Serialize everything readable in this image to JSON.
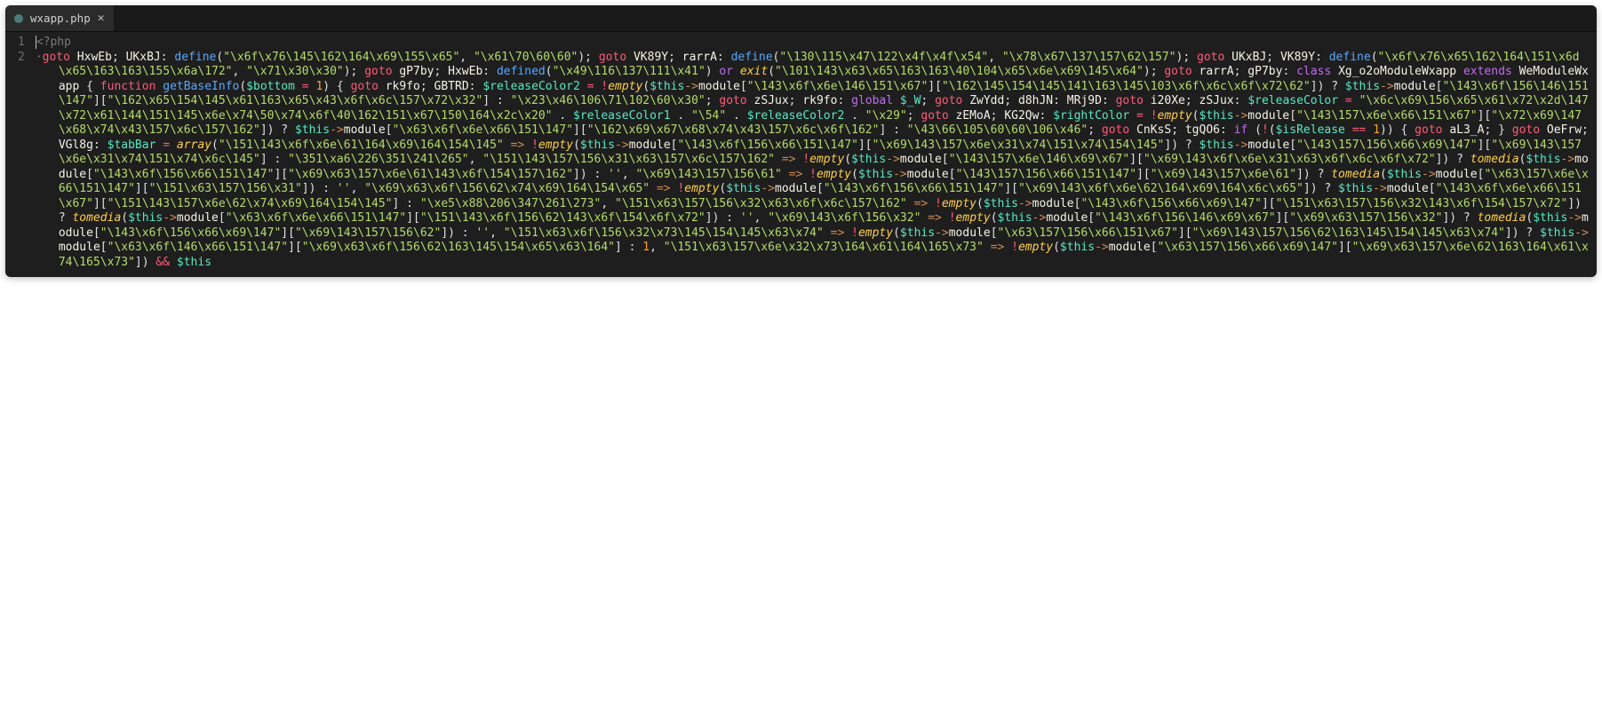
{
  "tab": {
    "filename": "wxapp.php",
    "icon": "php-icon",
    "close": "✕"
  },
  "gutter": {
    "l1": "1",
    "l2": "2"
  },
  "code": {
    "php_open": "<?php",
    "tokens": {
      "goto": "goto",
      "define": "define",
      "defined": "defined",
      "or": "or",
      "exit": "exit",
      "class": "class",
      "extends": "extends",
      "function": "function",
      "global": "global",
      "if": "if",
      "empty": "empty",
      "tomedia": "tomedia",
      "module": "module",
      "arrow": "->",
      "fat_arrow": "=>",
      "and": "&&",
      "array": "array"
    },
    "labels": {
      "HxwEb": "HxwEb",
      "UKxBJ": "UKxBJ",
      "VK89Y": "VK89Y",
      "rarrA": "rarrA",
      "gP7by": "gP7by",
      "rk9fo": "rk9fo",
      "GBTRD": "GBTRD",
      "zSJux": "zSJux",
      "ZwYdd": "ZwYdd",
      "d8hJN": "d8hJN",
      "MRj9D": "MRj9D",
      "i20Xe": "i20Xe",
      "zEMoA": "zEMoA",
      "KG2Qw": "KG2Qw",
      "CnKsS": "CnKsS",
      "tgQO6": "tgQO6",
      "aL3_A": "aL3_A",
      "OeFrw": "OeFrw",
      "VGl8g": "VGl8g"
    },
    "idents": {
      "class_name": "Xg_o2oModuleWxapp",
      "parent": "WeModuleWxapp",
      "fn": "getBaseInfo"
    },
    "vars": {
      "bottom": "$bottom",
      "releaseColor2": "$releaseColor2",
      "releaseColor1": "$releaseColor1",
      "releaseColor": "$releaseColor",
      "rightColor": "$rightColor",
      "W": "$_W",
      "this": "$this",
      "isRelease": "$isRelease",
      "tabBar": "$tabBar"
    },
    "nums": {
      "one": "1",
      "two": "2"
    },
    "strings": {
      "s_overtime_k": "\"\\x6f\\x76\\145\\162\\164\\x69\\155\\x65\"",
      "s_1700": "\"\\x61\\70\\60\\60\"",
      "s_XMGZ": "\"\\130\\115\\x47\\122\\x4f\\x4f\\x54\"",
      "s_xg_o2o": "\"\\x78\\x67\\137\\157\\62\\157\"",
      "s_overtimemjr": "\"\\x6f\\x76\\x65\\162\\164\\151\\x6d\\x65\\163\\163\\155\\x6a\\172\"",
      "s_q00": "\"\\x71\\x30\\x30\"",
      "s_IN_IA": "\"\\x49\\116\\137\\111\\x41\"",
      "s_access_denied": "\"\\101\\143\\x63\\x65\\163\\163\\40\\104\\x65\\x6e\\x69\\145\\x64\"",
      "s_config1": "\"\\143\\x6f\\x6e\\146\\151\\x67\"",
      "s_r_rC1_f": "\"\\162\\145\\154\\145\\141\\163\\145\\103\\x6f\\x6c\\x6f\\x72\\62\"",
      "s_r_rC2_k": "\"\\162\\x65\\154\\145\\x61\\163\\x65\\x43\\x6f\\x6c\\157\\x72\\x32\"",
      "s_config2": "\"\\143\\x6f\\156\\146\\151\\147\"",
      "s_hex1": "\"\\x23\\x46\\106\\71\\102\\60\\x30\"",
      "s_linear1": "\"\\x6c\\x69\\156\\x65\\x61\\x72\\x2d\\147\\x72\\x61\\144\\151\\145\\x6e\\x74\\50\\x74\\x6f\\40\\162\\151\\x67\\150\\164\\x2c\\x20\"",
      "s_54": "\"\\54\"",
      "s_29": "\"\\x29\"",
      "s_config3": "\"\\143\\157\\x6e\\x66\\151\\x67\"",
      "s_rightColor_k": "\"\\x72\\x69\\147\\x68\\x74\\x43\\157\\x6c\\157\\162\"",
      "s_config4": "\"\\x63\\x6f\\x6e\\x66\\151\\147\"",
      "s_rightColor_f": "\"\\162\\x69\\x67\\x68\\x74\\x43\\157\\x6c\\x6f\\162\"",
      "s_hex2": "\"\\43\\66\\105\\60\\60\\106\\x46\"",
      "s_icon1title_a": "\"\\151\\143\\x6f\\x6e\\61\\164\\x69\\164\\154\\145\"",
      "s_config5": "\"\\143\\x6f\\156\\x66\\151\\147\"",
      "s_icon1title_b": "\"\\x69\\143\\157\\x6e\\x31\\x74\\151\\x74\\154\\145\"",
      "s_config6": "\"\\143\\157\\156\\x66\\x69\\147\"",
      "s_icon1title_c": "\"\\x69\\143\\157\\x6e\\x31\\x74\\151\\x74\\x6c\\145\"",
      "s_cn1": "\"\\351\\xa6\\226\\351\\241\\265\"",
      "s_icon1color_k": "\"\\151\\143\\157\\156\\x31\\x63\\157\\x6c\\157\\162\"",
      "s_config7": "\"\\143\\157\\x6e\\146\\x69\\x67\"",
      "s_icon1color_f": "\"\\x69\\143\\x6f\\x6e\\x31\\x63\\x6f\\x6c\\x6f\\x72\"",
      "s_config8": "\"\\143\\x6f\\156\\x66\\151\\147\"",
      "s_icon1color_b": "\"\\x69\\x63\\157\\x6e\\61\\143\\x6f\\154\\157\\162\"",
      "s_icon1_k": "\"\\x69\\143\\157\\156\\61\"",
      "s_config9": "\"\\143\\157\\156\\x66\\151\\147\"",
      "s_icon1_f": "\"\\x69\\143\\157\\x6e\\61\"",
      "s_config10": "\"\\x63\\157\\x6e\\x66\\151\\147\"",
      "s_icon1_b": "\"\\151\\x63\\157\\156\\x31\"",
      "s_icon2title_k": "\"\\x69\\x63\\x6f\\156\\62\\x74\\x69\\164\\154\\x65\"",
      "s_config11": "\"\\143\\x6f\\156\\x66\\151\\147\"",
      "s_icon2title_b": "\"\\x69\\143\\x6f\\x6e\\62\\164\\x69\\164\\x6c\\x65\"",
      "s_config12": "\"\\143\\x6f\\x6e\\x66\\151\\x67\"",
      "s_icon2title_c": "\"\\151\\143\\157\\x6e\\62\\x74\\x69\\164\\154\\145\"",
      "s_cn2": "\"\\xe5\\x88\\206\\347\\261\\273\"",
      "s_icon2color_k": "\"\\151\\x63\\157\\156\\x32\\x63\\x6f\\x6c\\157\\162\"",
      "s_config13": "\"\\143\\x6f\\156\\x66\\x69\\147\"",
      "s_icon2color_b": "\"\\151\\x63\\157\\156\\x32\\143\\x6f\\154\\157\\x72\"",
      "s_config14": "\"\\x63\\x6f\\x6e\\x66\\151\\147\"",
      "s_icon2color_c": "\"\\151\\143\\x6f\\156\\62\\143\\x6f\\154\\x6f\\x72\"",
      "s_icon2_k": "\"\\x69\\143\\x6f\\156\\x32\"",
      "s_config15": "\"\\143\\x6f\\156\\146\\x69\\x67\"",
      "s_icon2_f": "\"\\x69\\x63\\157\\156\\x32\"",
      "s_config16": "\"\\143\\x6f\\156\\x66\\x69\\147\"",
      "s_icon2_b": "\"\\x69\\143\\157\\156\\62\"",
      "s_icon2select_k": "\"\\151\\x63\\x6f\\156\\x32\\x73\\145\\154\\145\\x63\\x74\"",
      "s_config17": "\"\\x63\\157\\156\\x66\\151\\x67\"",
      "s_icon2select_b": "\"\\x69\\143\\157\\156\\62\\163\\145\\154\\145\\x63\\x74\"",
      "s_config18": "\"\\x63\\x6f\\146\\x66\\151\\147\"",
      "s_icon2select_c": "\"\\x69\\x63\\x6f\\156\\62\\163\\145\\154\\x65\\x63\\164\"",
      "s_icn2status_k": "\"\\151\\x63\\157\\x6e\\x32\\x73\\164\\x61\\164\\165\\x73\"",
      "s_config19": "\"\\x63\\157\\156\\x66\\x69\\147\"",
      "s_icn2status_b": "\"\\x69\\x63\\157\\x6e\\62\\163\\164\\x61\\x74\\165\\x73\"",
      "s_empty": "''"
    }
  }
}
